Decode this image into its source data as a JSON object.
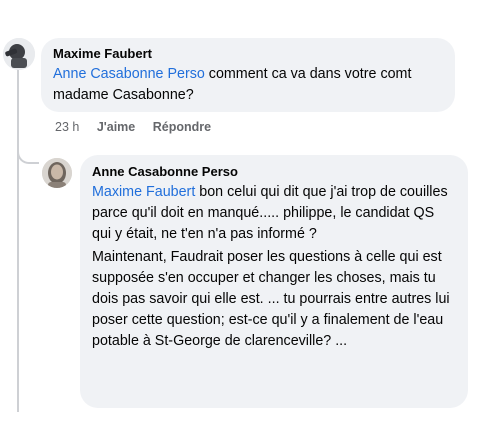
{
  "comment": {
    "author": "Maxime Faubert",
    "mention": "Anne Casabonne Perso",
    "text": " comment ca va dans votre comt madame Casabonne?",
    "time": "23 h",
    "like_label": "J'aime",
    "reply_label": "Répondre"
  },
  "reply": {
    "author": "Anne Casabonne Perso",
    "mention": "Maxime Faubert",
    "text1": " bon celui qui dit que j'ai trop de couilles parce qu'il doit en manqué..... philippe, le candidat QS qui y était, ne t'en n'a pas informé ?",
    "text2": " Maintenant, Faudrait poser les questions à celle qui est supposée s'en occuper et changer les choses, mais tu dois pas savoir qui elle est.  ... tu pourrais entre autres lui poser cette question; est-ce qu'il y a finalement de l'eau potable à St-George de clarenceville? ..."
  }
}
